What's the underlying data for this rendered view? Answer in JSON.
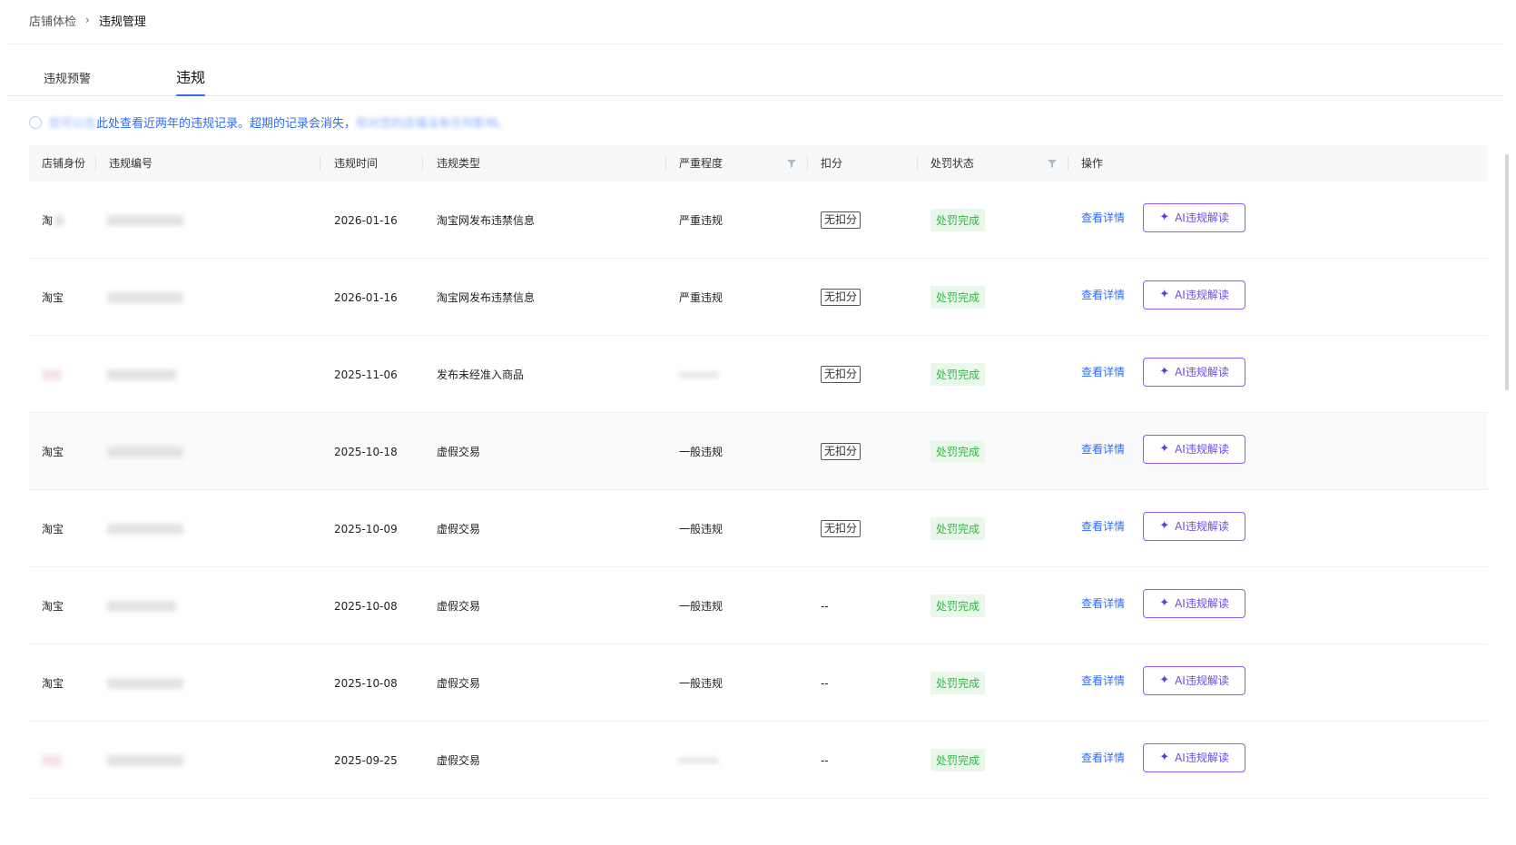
{
  "breadcrumb": {
    "parent": "店铺体检",
    "separator": "›",
    "current": "违规管理"
  },
  "tabs": [
    {
      "label": "违规预警",
      "active": false
    },
    {
      "label": "违规",
      "active": true
    }
  ],
  "notice": {
    "obscured_prefix": "您可以在",
    "text": "此处查看近两年的违规记录。超期的记录会消失，",
    "obscured_suffix": "但对您的店铺没有任何影响。"
  },
  "table": {
    "headers": {
      "identity": "店铺身份",
      "violation_id": "违规编号",
      "time": "违规时间",
      "type": "违规类型",
      "severity": "严重程度",
      "deduction": "扣分",
      "status": "处罚状态",
      "actions": "操作"
    },
    "rows": [
      {
        "identity": "淘",
        "time": "2026-01-16",
        "type": "淘宝网发布违禁信息",
        "severity": "严重违规",
        "deduction": "无扣分",
        "status": "处罚完成",
        "detail": "查看详情",
        "ai": "AI违规解读",
        "identity_blur": true
      },
      {
        "identity": "淘宝",
        "time": "2026-01-16",
        "type": "淘宝网发布违禁信息",
        "severity": "严重违规",
        "deduction": "无扣分",
        "status": "处罚完成",
        "detail": "查看详情",
        "ai": "AI违规解读"
      },
      {
        "identity": "",
        "time": "2025-11-06",
        "type": "发布未经准入商品",
        "severity": "",
        "deduction": "无扣分",
        "status": "处罚完成",
        "detail": "查看详情",
        "ai": "AI违规解读",
        "severity_blur": true
      },
      {
        "identity": "淘宝",
        "time": "2025-10-18",
        "type": "虚假交易",
        "severity": "一般违规",
        "deduction": "无扣分",
        "status": "处罚完成",
        "detail": "查看详情",
        "ai": "AI违规解读",
        "highlight": true
      },
      {
        "identity": "淘宝",
        "time": "2025-10-09",
        "type": "虚假交易",
        "severity": "一般违规",
        "deduction": "无扣分",
        "status": "处罚完成",
        "detail": "查看详情",
        "ai": "AI违规解读"
      },
      {
        "identity": "淘宝",
        "time": "2025-10-08",
        "type": "虚假交易",
        "severity": "一般违规",
        "deduction": "--",
        "status": "处罚完成",
        "detail": "查看详情",
        "ai": "AI违规解读"
      },
      {
        "identity": "淘宝",
        "time": "2025-10-08",
        "type": "虚假交易",
        "severity": "一般违规",
        "deduction": "--",
        "status": "处罚完成",
        "detail": "查看详情",
        "ai": "AI违规解读"
      },
      {
        "identity": "",
        "time": "2025-09-25",
        "type": "虚假交易",
        "severity": "",
        "deduction": "--",
        "status": "处罚完成",
        "detail": "查看详情",
        "ai": "AI违规解读",
        "severity_blur": true
      }
    ]
  },
  "colors": {
    "accent": "#2f6bff",
    "status_green": "#33b54a",
    "ai_purple": "#8b5cf6"
  },
  "icons": {
    "filter": "filter-icon",
    "sparkle": "sparkle-icon",
    "info": "info-icon",
    "chevron": "chevron-right-icon"
  }
}
